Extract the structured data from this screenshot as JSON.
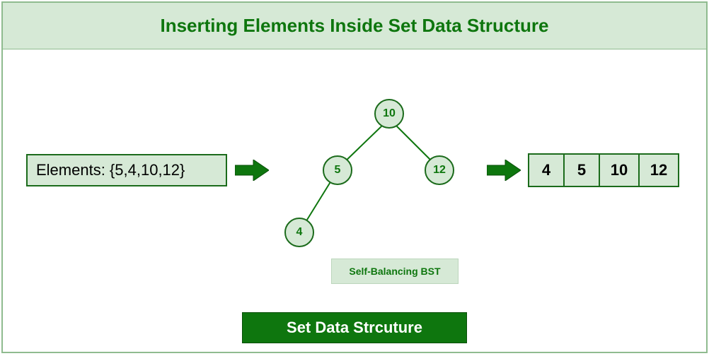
{
  "title": "Inserting Elements Inside Set Data Structure",
  "elements_label": "Elements:  {5,4,10,12}",
  "tree": {
    "nodes": {
      "root": "10",
      "left": "5",
      "right": "12",
      "leftleft": "4"
    },
    "caption": "Self-Balancing BST"
  },
  "output": [
    "4",
    "5",
    "10",
    "12"
  ],
  "footer": "Set Data Strcuture",
  "colors": {
    "accent": "#0e760e",
    "light": "#d6e9d6",
    "border": "#1b6b1b"
  },
  "chart_data": {
    "type": "diagram",
    "input_set": [
      5,
      4,
      10,
      12
    ],
    "bst_structure": {
      "value": 10,
      "left": {
        "value": 5,
        "left": {
          "value": 4
        }
      },
      "right": {
        "value": 12
      }
    },
    "sorted_output": [
      4,
      5,
      10,
      12
    ]
  }
}
